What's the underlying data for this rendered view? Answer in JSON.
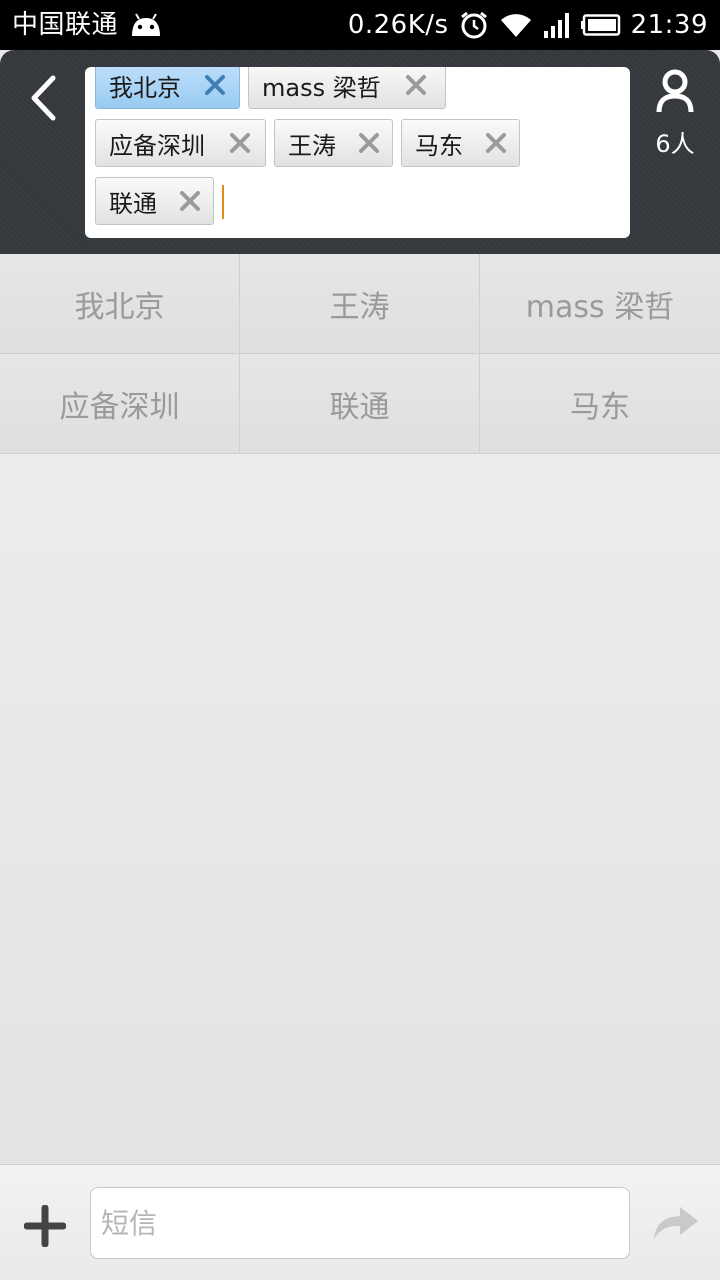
{
  "status_bar": {
    "carrier": "中国联通",
    "speed": "0.26K/s",
    "time": "21:39",
    "icons": [
      "android-icon",
      "alarm-icon",
      "wifi-icon",
      "signal-icon",
      "battery-icon"
    ]
  },
  "header": {
    "back_icon": "chevron-left-icon",
    "recipients": [
      {
        "name": "我北京",
        "selected": true
      },
      {
        "name": "mass 梁哲",
        "selected": false
      },
      {
        "name": "应备深圳",
        "selected": false
      },
      {
        "name": "王涛",
        "selected": false
      },
      {
        "name": "马东",
        "selected": false
      },
      {
        "name": "联通",
        "selected": false
      }
    ],
    "contacts_icon": "person-icon",
    "contacts_count": "6人"
  },
  "suggestions": [
    "我北京",
    "王涛",
    "mass 梁哲",
    "应备深圳",
    "联通",
    "马东"
  ],
  "composer": {
    "add_icon": "plus-icon",
    "placeholder": "短信",
    "value": "",
    "send_icon": "send-arrow-icon"
  },
  "colors": {
    "header_bg": "#35383c",
    "chip_selected": "#a8d3f6",
    "cursor": "#e58a1e"
  }
}
